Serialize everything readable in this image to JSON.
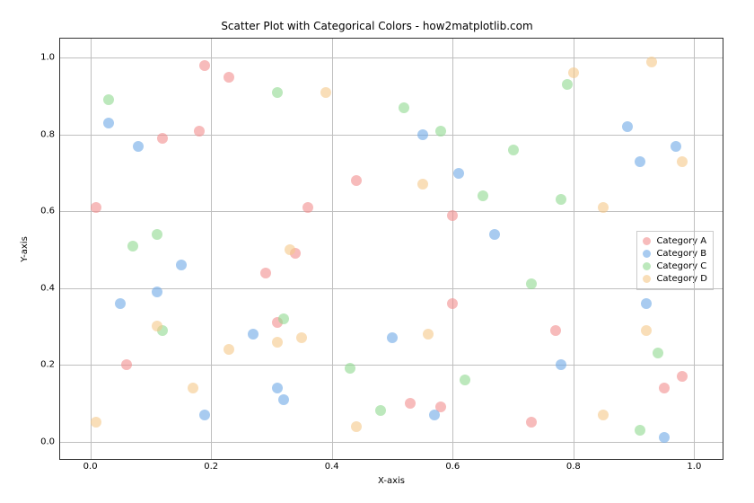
{
  "chart_data": {
    "type": "scatter",
    "title": "Scatter Plot with Categorical Colors - how2matplotlib.com",
    "xlabel": "X-axis",
    "ylabel": "Y-axis",
    "xlim": [
      -0.05,
      1.05
    ],
    "ylim": [
      -0.05,
      1.05
    ],
    "xticks": [
      0.0,
      0.2,
      0.4,
      0.6,
      0.8,
      1.0
    ],
    "yticks": [
      0.0,
      0.2,
      0.4,
      0.6,
      0.8,
      1.0
    ],
    "xtick_labels": [
      "0.0",
      "0.2",
      "0.4",
      "0.6",
      "0.8",
      "1.0"
    ],
    "ytick_labels": [
      "0.0",
      "0.2",
      "0.4",
      "0.6",
      "0.8",
      "1.0"
    ],
    "grid": true,
    "legend_position": "right",
    "colors": {
      "A": "#f28e8e",
      "B": "#6ea8e6",
      "C": "#8fd98f",
      "D": "#f5c889"
    },
    "series": [
      {
        "name": "Category A",
        "color": "#f28e8e",
        "points": [
          {
            "x": 0.01,
            "y": 0.61
          },
          {
            "x": 0.06,
            "y": 0.2
          },
          {
            "x": 0.12,
            "y": 0.79
          },
          {
            "x": 0.18,
            "y": 0.81
          },
          {
            "x": 0.19,
            "y": 0.98
          },
          {
            "x": 0.23,
            "y": 0.95
          },
          {
            "x": 0.29,
            "y": 0.44
          },
          {
            "x": 0.31,
            "y": 0.31
          },
          {
            "x": 0.34,
            "y": 0.49
          },
          {
            "x": 0.36,
            "y": 0.61
          },
          {
            "x": 0.44,
            "y": 0.68
          },
          {
            "x": 0.53,
            "y": 0.1
          },
          {
            "x": 0.58,
            "y": 0.09
          },
          {
            "x": 0.6,
            "y": 0.36
          },
          {
            "x": 0.6,
            "y": 0.59
          },
          {
            "x": 0.73,
            "y": 0.05
          },
          {
            "x": 0.77,
            "y": 0.29
          },
          {
            "x": 0.95,
            "y": 0.14
          },
          {
            "x": 0.98,
            "y": 0.17
          }
        ]
      },
      {
        "name": "Category B",
        "color": "#6ea8e6",
        "points": [
          {
            "x": 0.03,
            "y": 0.83
          },
          {
            "x": 0.05,
            "y": 0.36
          },
          {
            "x": 0.08,
            "y": 0.77
          },
          {
            "x": 0.11,
            "y": 0.39
          },
          {
            "x": 0.15,
            "y": 0.46
          },
          {
            "x": 0.19,
            "y": 0.07
          },
          {
            "x": 0.27,
            "y": 0.28
          },
          {
            "x": 0.31,
            "y": 0.14
          },
          {
            "x": 0.32,
            "y": 0.11
          },
          {
            "x": 0.5,
            "y": 0.27
          },
          {
            "x": 0.55,
            "y": 0.8
          },
          {
            "x": 0.57,
            "y": 0.07
          },
          {
            "x": 0.61,
            "y": 0.7
          },
          {
            "x": 0.67,
            "y": 0.54
          },
          {
            "x": 0.78,
            "y": 0.2
          },
          {
            "x": 0.89,
            "y": 0.82
          },
          {
            "x": 0.91,
            "y": 0.73
          },
          {
            "x": 0.92,
            "y": 0.36
          },
          {
            "x": 0.95,
            "y": 0.01
          },
          {
            "x": 0.97,
            "y": 0.77
          }
        ]
      },
      {
        "name": "Category C",
        "color": "#8fd98f",
        "points": [
          {
            "x": 0.03,
            "y": 0.89
          },
          {
            "x": 0.07,
            "y": 0.51
          },
          {
            "x": 0.11,
            "y": 0.54
          },
          {
            "x": 0.12,
            "y": 0.29
          },
          {
            "x": 0.31,
            "y": 0.91
          },
          {
            "x": 0.32,
            "y": 0.32
          },
          {
            "x": 0.43,
            "y": 0.19
          },
          {
            "x": 0.48,
            "y": 0.08
          },
          {
            "x": 0.52,
            "y": 0.87
          },
          {
            "x": 0.58,
            "y": 0.81
          },
          {
            "x": 0.62,
            "y": 0.16
          },
          {
            "x": 0.65,
            "y": 0.64
          },
          {
            "x": 0.7,
            "y": 0.76
          },
          {
            "x": 0.73,
            "y": 0.41
          },
          {
            "x": 0.78,
            "y": 0.63
          },
          {
            "x": 0.79,
            "y": 0.93
          },
          {
            "x": 0.91,
            "y": 0.03
          },
          {
            "x": 0.94,
            "y": 0.23
          }
        ]
      },
      {
        "name": "Category D",
        "color": "#f5c889",
        "points": [
          {
            "x": 0.01,
            "y": 0.05
          },
          {
            "x": 0.11,
            "y": 0.3
          },
          {
            "x": 0.17,
            "y": 0.14
          },
          {
            "x": 0.23,
            "y": 0.24
          },
          {
            "x": 0.31,
            "y": 0.26
          },
          {
            "x": 0.33,
            "y": 0.5
          },
          {
            "x": 0.35,
            "y": 0.27
          },
          {
            "x": 0.39,
            "y": 0.91
          },
          {
            "x": 0.44,
            "y": 0.04
          },
          {
            "x": 0.55,
            "y": 0.67
          },
          {
            "x": 0.56,
            "y": 0.28
          },
          {
            "x": 0.8,
            "y": 0.96
          },
          {
            "x": 0.85,
            "y": 0.07
          },
          {
            "x": 0.85,
            "y": 0.61
          },
          {
            "x": 0.92,
            "y": 0.29
          },
          {
            "x": 0.93,
            "y": 0.99
          },
          {
            "x": 0.98,
            "y": 0.73
          }
        ]
      }
    ]
  }
}
